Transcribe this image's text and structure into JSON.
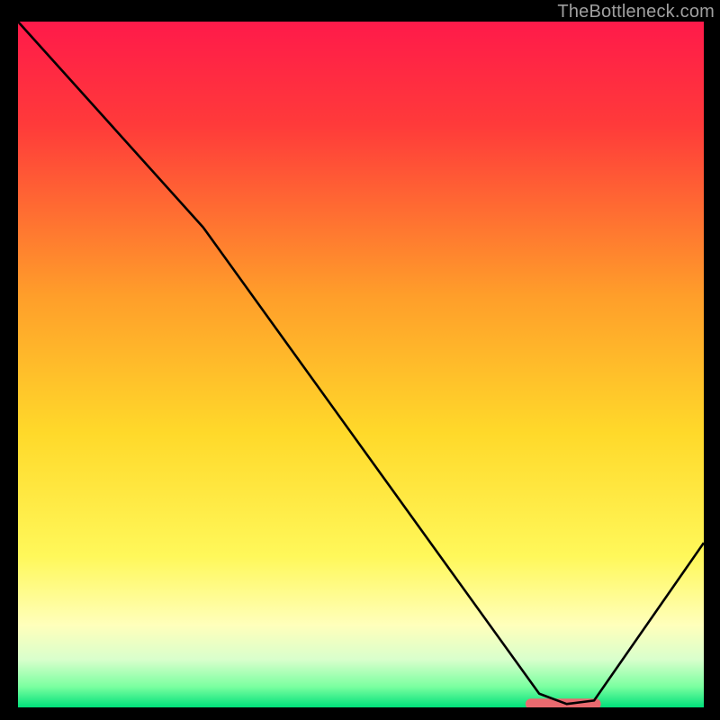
{
  "watermark": "TheBottleneck.com",
  "chart_data": {
    "type": "line",
    "title": "",
    "xlabel": "",
    "ylabel": "",
    "xlim": [
      0,
      100
    ],
    "ylim": [
      0,
      100
    ],
    "series": [
      {
        "name": "curve",
        "x": [
          0,
          27,
          76,
          80,
          84,
          100
        ],
        "values": [
          100,
          70,
          2,
          0.5,
          1,
          24
        ]
      }
    ],
    "gradient_stops": [
      {
        "offset": 0.0,
        "color": "#ff1a4a"
      },
      {
        "offset": 0.15,
        "color": "#ff3a3a"
      },
      {
        "offset": 0.4,
        "color": "#ff9e2a"
      },
      {
        "offset": 0.6,
        "color": "#ffd92a"
      },
      {
        "offset": 0.78,
        "color": "#fff85a"
      },
      {
        "offset": 0.88,
        "color": "#ffffbb"
      },
      {
        "offset": 0.93,
        "color": "#d9ffcc"
      },
      {
        "offset": 0.97,
        "color": "#7affa0"
      },
      {
        "offset": 1.0,
        "color": "#00e07a"
      }
    ],
    "marker": {
      "x_range": [
        74,
        85
      ],
      "y": 0.5,
      "color": "#e96a6f"
    }
  }
}
